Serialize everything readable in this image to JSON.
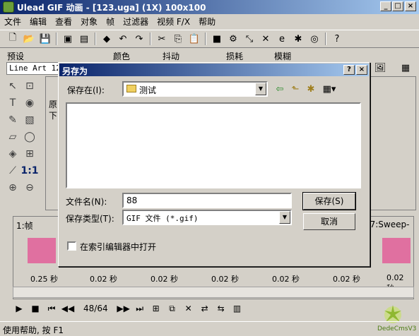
{
  "window": {
    "title": "Ulead GIF 动画 - [123.uga] (1X) 100x100"
  },
  "menu": [
    "文件",
    "编辑",
    "查看",
    "对象",
    "帧",
    "过滤器",
    "视频 F/X",
    "帮助"
  ],
  "presets": {
    "labels": [
      "预设",
      "颜色",
      "抖动",
      "损耗",
      "模糊"
    ],
    "preset_value": "Line Art 128"
  },
  "panel_text": {
    "left_a": "原",
    "left_b": "下"
  },
  "frames": {
    "label": "1:帧",
    "right_label": "k, 7:Sweep-",
    "times": [
      "0.25 秒",
      "0.02 秒",
      "0.02 秒",
      "0.02 秒",
      "0.02 秒",
      "0.02 秒",
      "0.02 秒"
    ]
  },
  "playback": {
    "counter": "48/64"
  },
  "status": "使用帮助, 按 F1",
  "watermark": "DedeCmsV3",
  "dialog": {
    "title": "另存为",
    "save_in_label": "保存在(I):",
    "save_in_value": "测试",
    "filename_label": "文件名(N):",
    "filename_value": "88",
    "filetype_label": "保存类型(T):",
    "filetype_value": "GIF 文件 (*.gif)",
    "save_button": "保存(S)",
    "cancel_button": "取消",
    "open_checkbox_label": "在索引编辑器中打开",
    "open_checkbox_checked": false
  },
  "icons": [
    "app-icon",
    "new-icon",
    "open-icon",
    "save-icon",
    "cut-icon",
    "copy-icon",
    "paste-icon",
    "undo-icon",
    "redo-icon",
    "help-icon",
    "folder-icon",
    "back-icon",
    "up-folder-icon",
    "new-folder-icon",
    "view-menu-icon"
  ],
  "colors": {
    "titlebar_start": "#0a246a",
    "titlebar_end": "#a6caf0",
    "face": "#d4d0c8"
  }
}
